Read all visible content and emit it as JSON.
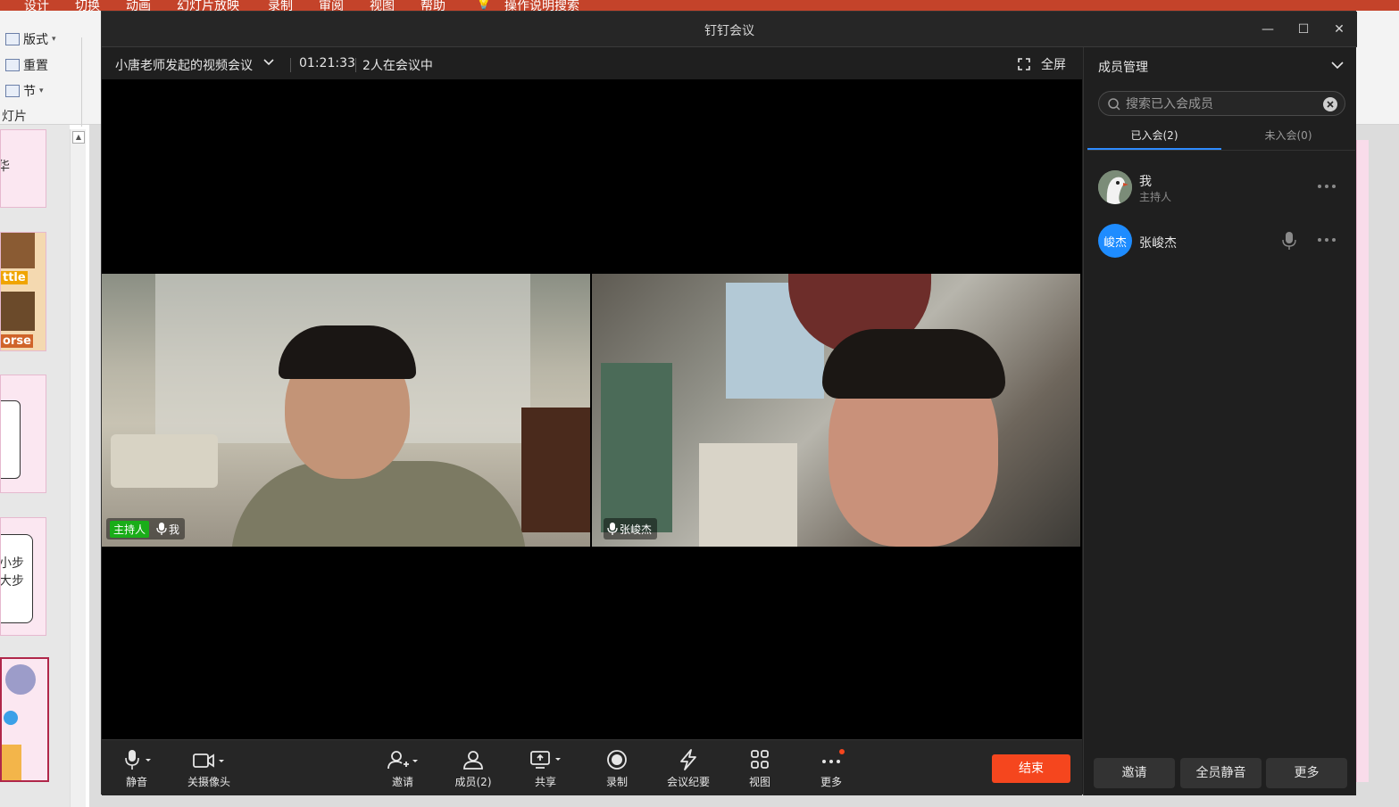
{
  "ppt": {
    "tabs": [
      "设计",
      "切换",
      "动画",
      "幻灯片放映",
      "录制",
      "审阅",
      "视图",
      "帮助"
    ],
    "tell_me": "操作说明搜索",
    "layout_label": "版式",
    "reset_label": "重置",
    "section_label": "节",
    "group_label": "灯片",
    "thumbs": [
      {
        "text": "华"
      },
      {
        "text": "ttle",
        "text2": "orse"
      },
      {
        "text": ""
      },
      {
        "text": "小步",
        "text2": "大步"
      },
      {
        "text": ""
      }
    ]
  },
  "window": {
    "title": "钉钉会议",
    "controls": {
      "minimize": "—",
      "maximize": "☐",
      "close": "✕"
    }
  },
  "meeting": {
    "name": "小唐老师发起的视频会议",
    "duration": "01:21:33",
    "participants_text": "2人在会议中",
    "fullscreen_label": "全屏"
  },
  "videos": [
    {
      "host_badge": "主持人",
      "name": "我"
    },
    {
      "name": "张峻杰"
    }
  ],
  "toolbar": {
    "mute": "静音",
    "camera_off": "关摄像头",
    "invite": "邀请",
    "members": "成员(2)",
    "share": "共享",
    "record": "录制",
    "minutes": "会议纪要",
    "view": "视图",
    "more": "更多",
    "end": "结束"
  },
  "panel": {
    "title": "成员管理",
    "search_placeholder": "搜索已入会成员",
    "tabs": {
      "joined": "已入会(2)",
      "not_joined": "未入会(0)"
    },
    "members": [
      {
        "name": "我",
        "role": "主持人"
      },
      {
        "name": "张峻杰",
        "avatar_text": "峻杰",
        "avatar_color": "#1e8cff"
      }
    ],
    "buttons": {
      "invite": "邀请",
      "mute_all": "全员静音",
      "more": "更多"
    }
  },
  "colors": {
    "end_button": "#f5461e",
    "host_badge": "#1aad19",
    "tab_underline": "#2e8bff",
    "notify_dot": "#f5461e"
  }
}
